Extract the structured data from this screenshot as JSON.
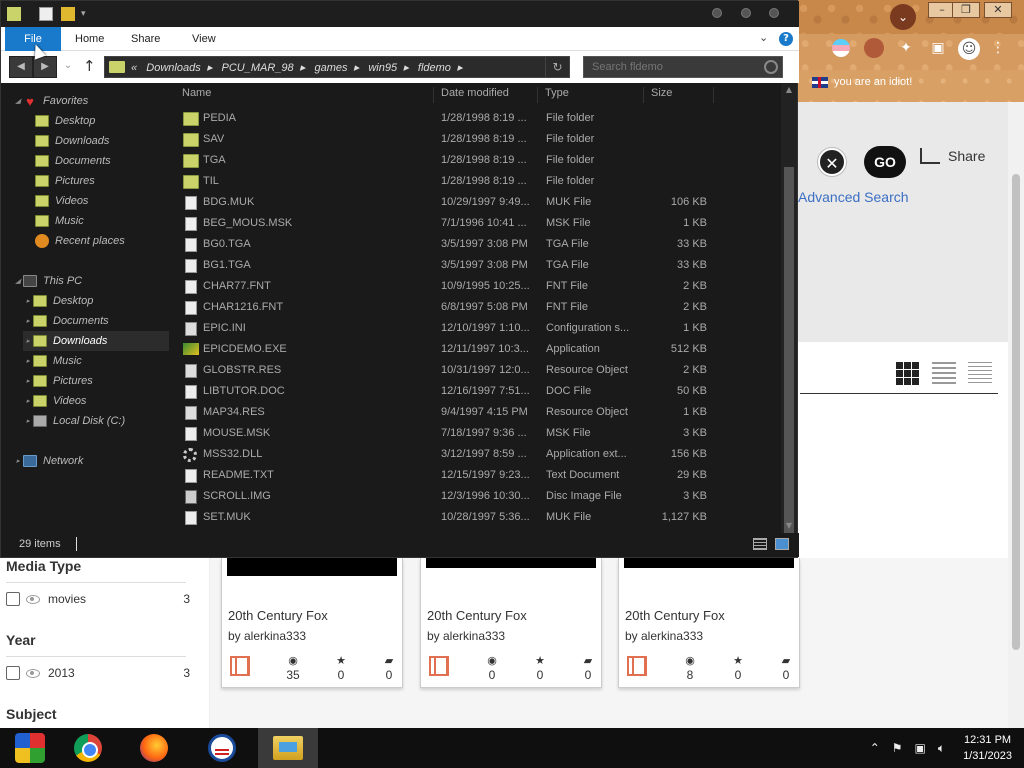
{
  "browser": {
    "bookmark_label": "you are an idiot!",
    "go_label": "GO",
    "share_label": "Share",
    "advanced_search": "Advanced Search",
    "facets": [
      {
        "title": "Media Type",
        "value": "movies",
        "count": "3"
      },
      {
        "title": "Year",
        "value": "2013",
        "count": "3"
      },
      {
        "title": "Subject"
      }
    ],
    "cards": [
      {
        "title": "20th Century Fox",
        "by": "by alerkina333",
        "views": "35",
        "favs": "0",
        "comments": "0"
      },
      {
        "title": "20th Century Fox",
        "by": "by alerkina333",
        "views": "0",
        "favs": "0",
        "comments": "0"
      },
      {
        "title": "20th Century Fox",
        "by": "by alerkina333",
        "views": "8",
        "favs": "0",
        "comments": "0"
      }
    ]
  },
  "explorer": {
    "ribbon": {
      "file": "File",
      "home": "Home",
      "share": "Share",
      "view": "View"
    },
    "address": {
      "prefix": "«",
      "crumbs": [
        "Downloads",
        "PCU_MAR_98",
        "games",
        "win95",
        "fldemo"
      ]
    },
    "search_placeholder": "Search fldemo",
    "nav": {
      "favorites": "Favorites",
      "fav_items": [
        "Desktop",
        "Downloads",
        "Documents",
        "Pictures",
        "Videos",
        "Music",
        "Recent places"
      ],
      "this_pc": "This PC",
      "pc_items": [
        "Desktop",
        "Documents",
        "Downloads",
        "Music",
        "Pictures",
        "Videos",
        "Local Disk (C:)"
      ],
      "network": "Network"
    },
    "columns": {
      "name": "Name",
      "date": "Date modified",
      "type": "Type",
      "size": "Size"
    },
    "files": [
      {
        "name": "PEDIA",
        "date": "1/28/1998 8:19 ...",
        "type": "File folder",
        "size": "",
        "icon": "folder"
      },
      {
        "name": "SAV",
        "date": "1/28/1998 8:19 ...",
        "type": "File folder",
        "size": "",
        "icon": "folder"
      },
      {
        "name": "TGA",
        "date": "1/28/1998 8:19 ...",
        "type": "File folder",
        "size": "",
        "icon": "folder"
      },
      {
        "name": "TIL",
        "date": "1/28/1998 8:19 ...",
        "type": "File folder",
        "size": "",
        "icon": "folder"
      },
      {
        "name": "BDG.MUK",
        "date": "10/29/1997 9:49...",
        "type": "MUK File",
        "size": "106 KB",
        "icon": "doc"
      },
      {
        "name": "BEG_MOUS.MSK",
        "date": "7/1/1996 10:41 ...",
        "type": "MSK File",
        "size": "1 KB",
        "icon": "doc"
      },
      {
        "name": "BG0.TGA",
        "date": "3/5/1997 3:08 PM",
        "type": "TGA File",
        "size": "33 KB",
        "icon": "doc"
      },
      {
        "name": "BG1.TGA",
        "date": "3/5/1997 3:08 PM",
        "type": "TGA File",
        "size": "33 KB",
        "icon": "doc"
      },
      {
        "name": "CHAR77.FNT",
        "date": "10/9/1995 10:25...",
        "type": "FNT File",
        "size": "2 KB",
        "icon": "doc"
      },
      {
        "name": "CHAR1216.FNT",
        "date": "6/8/1997 5:08 PM",
        "type": "FNT File",
        "size": "2 KB",
        "icon": "doc"
      },
      {
        "name": "EPIC.INI",
        "date": "12/10/1997 1:10...",
        "type": "Configuration s...",
        "size": "1 KB",
        "icon": "ini"
      },
      {
        "name": "EPICDEMO.EXE",
        "date": "12/11/1997 10:3...",
        "type": "Application",
        "size": "512 KB",
        "icon": "exe"
      },
      {
        "name": "GLOBSTR.RES",
        "date": "10/31/1997 12:0...",
        "type": "Resource Object",
        "size": "2 KB",
        "icon": "res"
      },
      {
        "name": "LIBTUTOR.DOC",
        "date": "12/16/1997 7:51...",
        "type": "DOC File",
        "size": "50 KB",
        "icon": "doc"
      },
      {
        "name": "MAP34.RES",
        "date": "9/4/1997 4:15 PM",
        "type": "Resource Object",
        "size": "1 KB",
        "icon": "res"
      },
      {
        "name": "MOUSE.MSK",
        "date": "7/18/1997 9:36 ...",
        "type": "MSK File",
        "size": "3 KB",
        "icon": "doc"
      },
      {
        "name": "MSS32.DLL",
        "date": "3/12/1997 8:59 ...",
        "type": "Application ext...",
        "size": "156 KB",
        "icon": "dll"
      },
      {
        "name": "README.TXT",
        "date": "12/15/1997 9:23...",
        "type": "Text Document",
        "size": "29 KB",
        "icon": "doc"
      },
      {
        "name": "SCROLL.IMG",
        "date": "12/3/1996 10:30...",
        "type": "Disc Image File",
        "size": "3 KB",
        "icon": "img"
      },
      {
        "name": "SET.MUK",
        "date": "10/28/1997 5:36...",
        "type": "MUK File",
        "size": "1,127 KB",
        "icon": "doc"
      }
    ],
    "status": "29 items"
  },
  "taskbar": {
    "time": "12:31 PM",
    "date": "1/31/2023"
  }
}
